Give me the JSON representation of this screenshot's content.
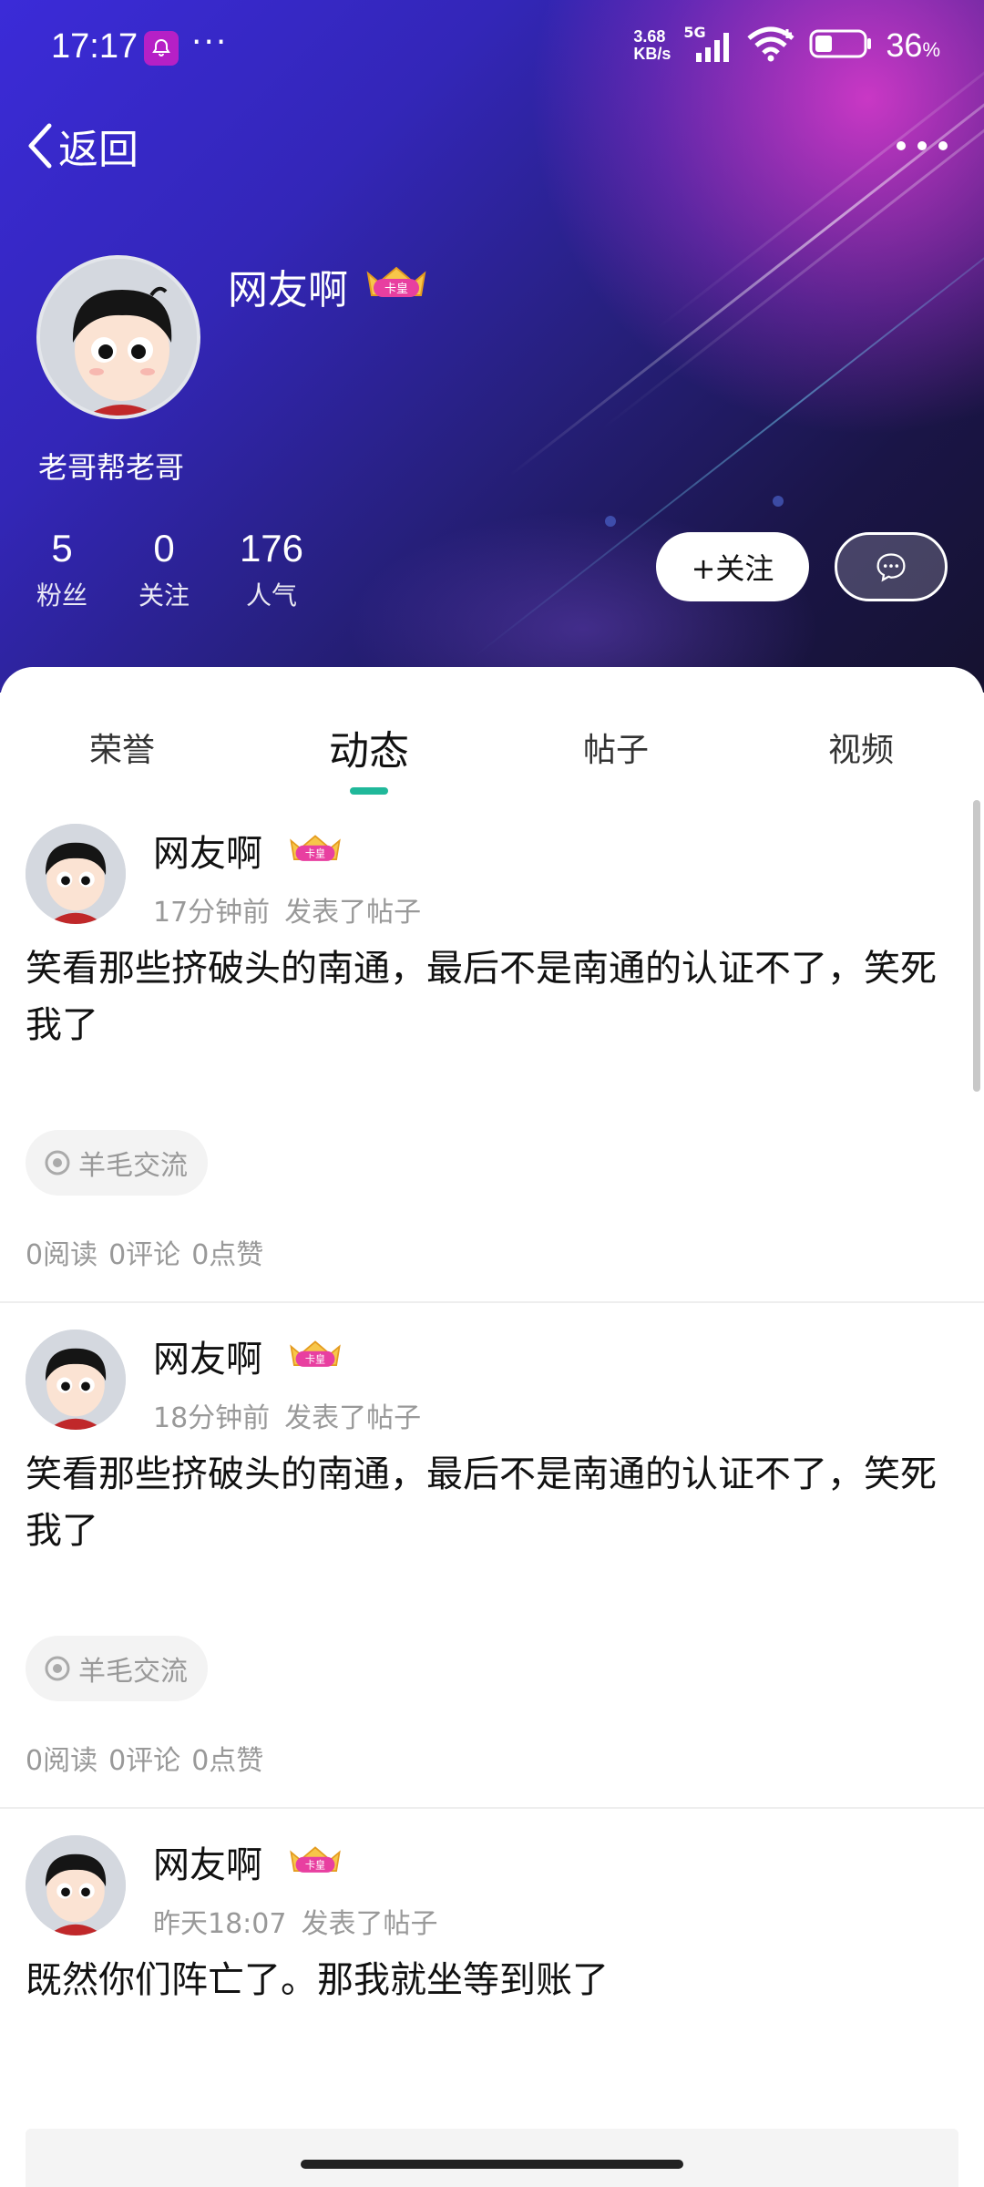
{
  "status_bar": {
    "time": "17:17",
    "more": "···",
    "net_speed_value": "3.68",
    "net_speed_unit": "KB/s",
    "network": "5G",
    "battery_value": "36",
    "battery_unit": "%"
  },
  "nav": {
    "back_label": "返回"
  },
  "profile": {
    "name": "网友啊",
    "badge_text": "卡皇",
    "signature": "老哥帮老哥",
    "stats": [
      {
        "value": "5",
        "label": "粉丝"
      },
      {
        "value": "0",
        "label": "关注"
      },
      {
        "value": "176",
        "label": "人气"
      }
    ],
    "follow_label": "+关注"
  },
  "tabs": [
    {
      "label": "荣誉"
    },
    {
      "label": "动态"
    },
    {
      "label": "帖子"
    },
    {
      "label": "视频"
    }
  ],
  "active_tab": "动态",
  "posts": [
    {
      "author": "网友啊",
      "time": "17分钟前",
      "action": "发表了帖子",
      "text": "笑看那些挤破头的南通，最后不是南通的认证不了，笑死我了",
      "tag": "羊毛交流",
      "stats": {
        "reads": "0阅读",
        "comments": "0评论",
        "likes": "0点赞"
      }
    },
    {
      "author": "网友啊",
      "time": "18分钟前",
      "action": "发表了帖子",
      "text": "笑看那些挤破头的南通，最后不是南通的认证不了，笑死我了",
      "tag": "羊毛交流",
      "stats": {
        "reads": "0阅读",
        "comments": "0评论",
        "likes": "0点赞"
      }
    },
    {
      "author": "网友啊",
      "time": "昨天18:07",
      "action": "发表了帖子",
      "text": "既然你们阵亡了。那我就坐等到账了"
    }
  ],
  "colors": {
    "accent": "#20b89a",
    "meta_text": "#999999",
    "badge": "#e83fa0"
  }
}
